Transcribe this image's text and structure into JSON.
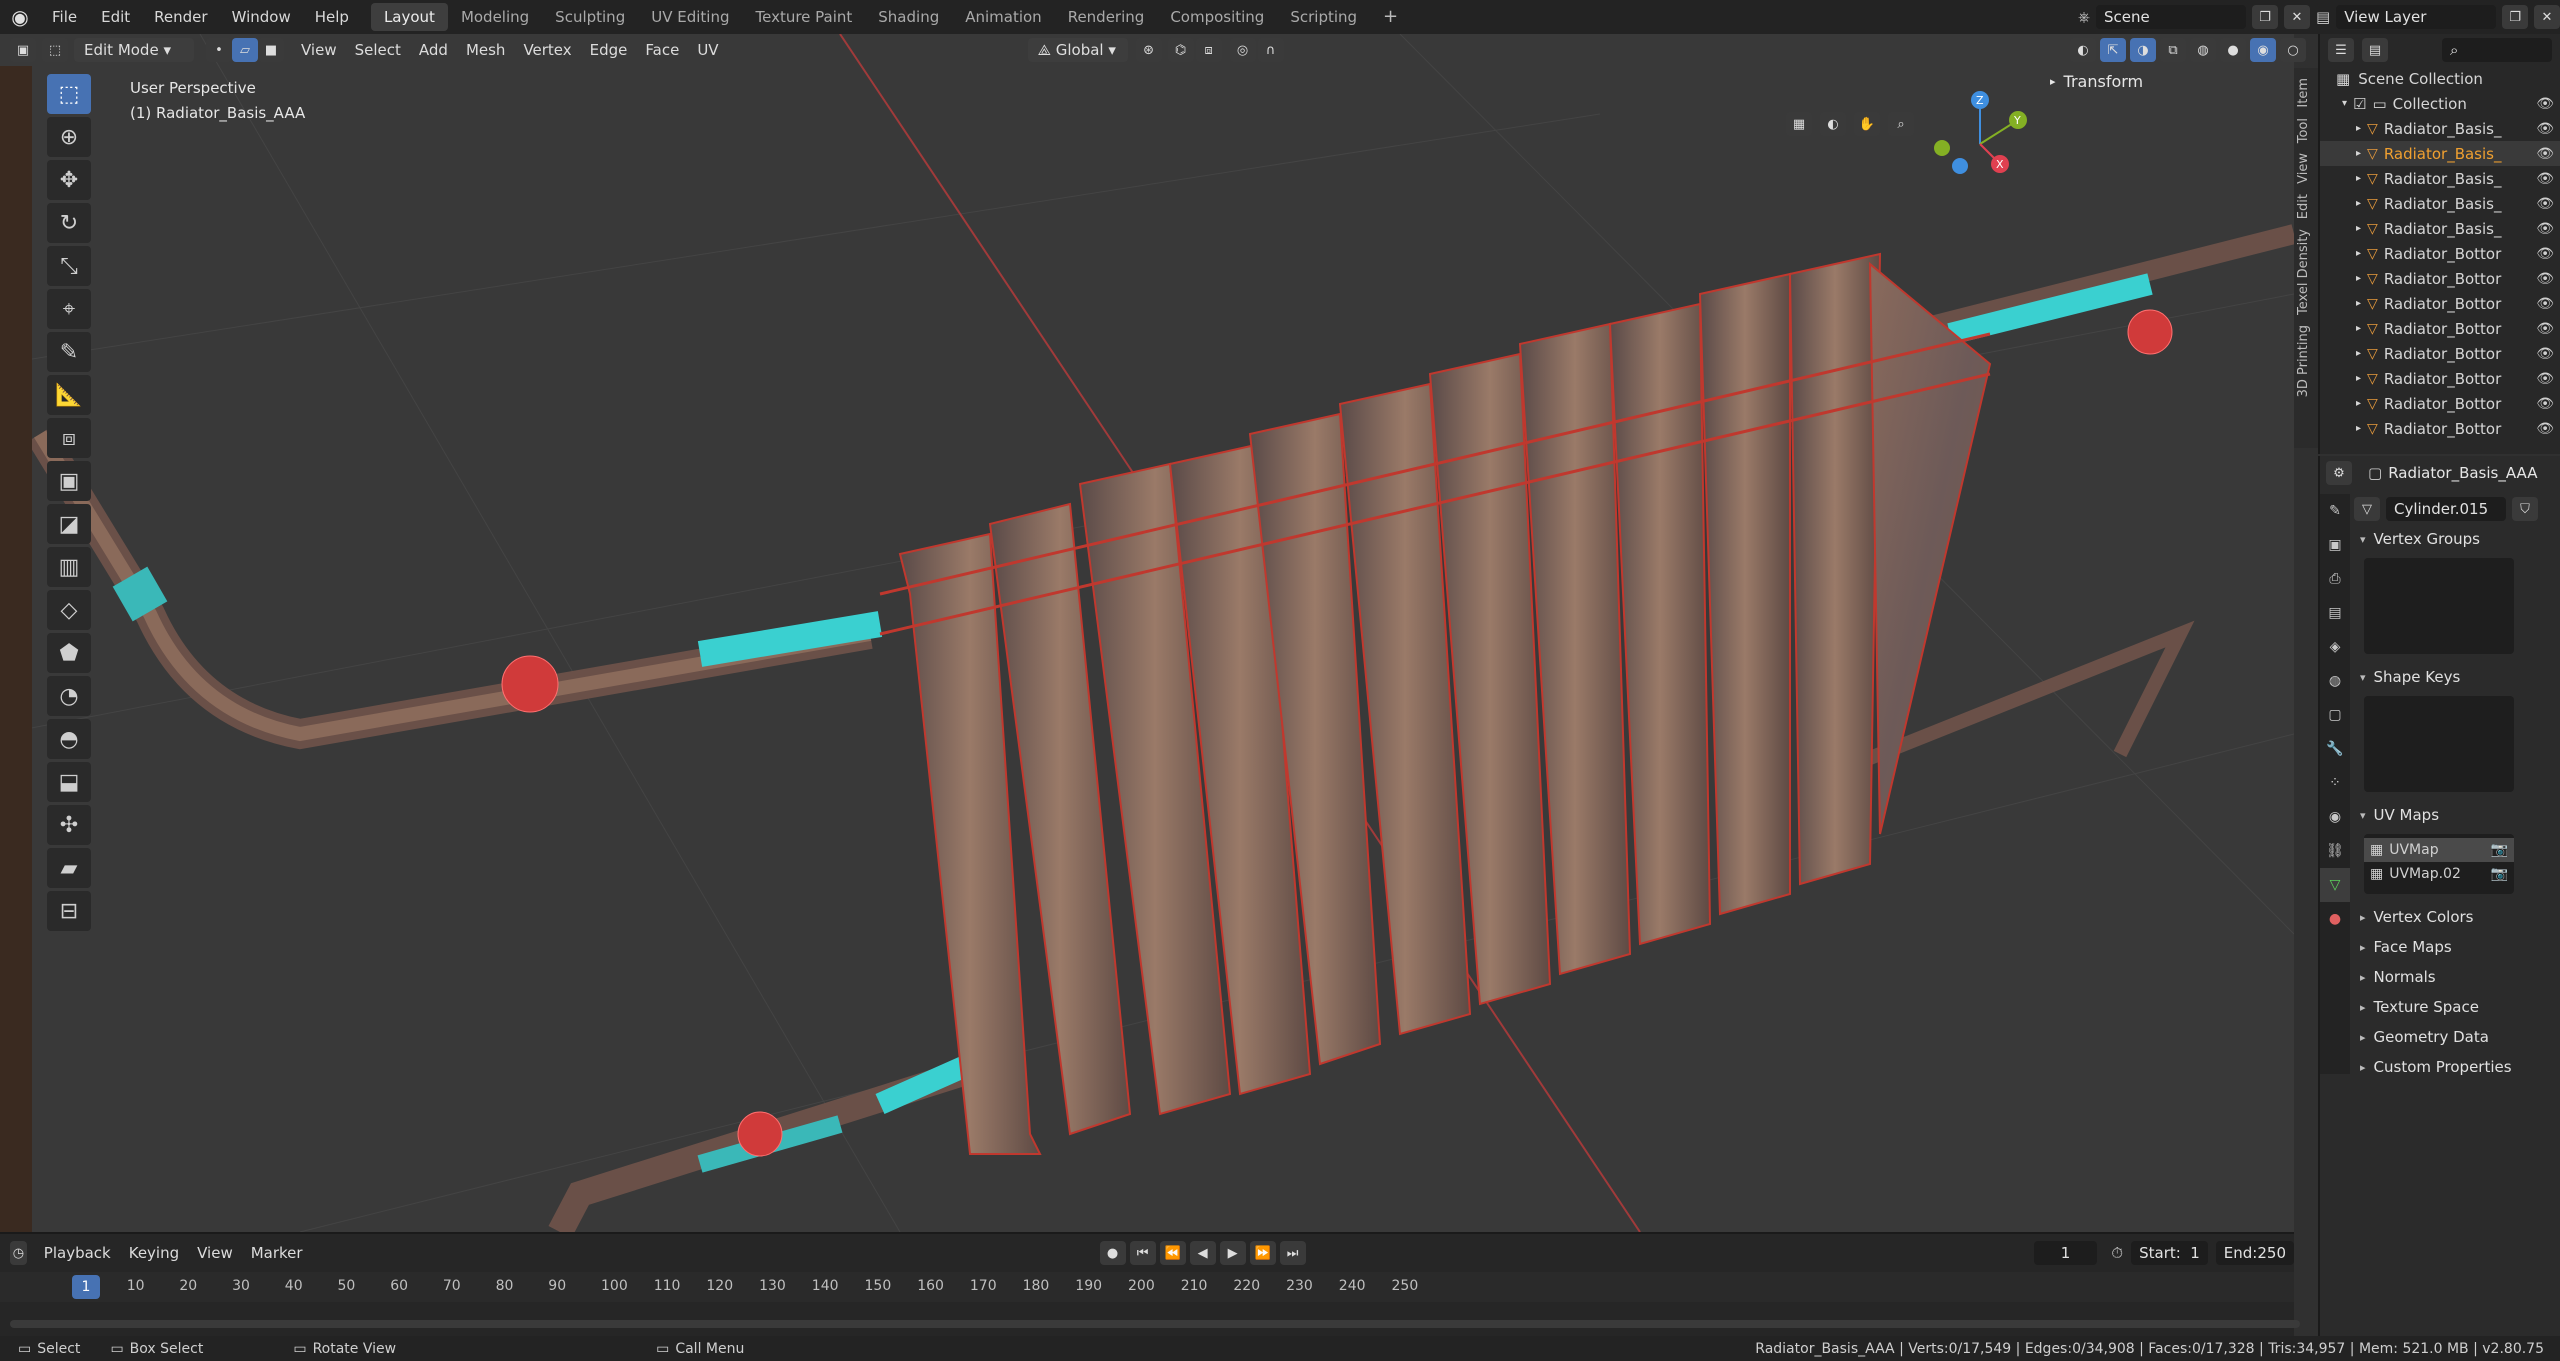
{
  "topbar": {
    "menus": [
      "File",
      "Edit",
      "Render",
      "Window",
      "Help"
    ],
    "workspaces": [
      "Layout",
      "Modeling",
      "Sculpting",
      "UV Editing",
      "Texture Paint",
      "Shading",
      "Animation",
      "Rendering",
      "Compositing",
      "Scripting"
    ],
    "active_workspace": "Layout",
    "scene_name": "Scene",
    "view_layer": "View Layer"
  },
  "viewport_header": {
    "mode": "Edit Mode",
    "menus": [
      "View",
      "Select",
      "Add",
      "Mesh",
      "Vertex",
      "Edge",
      "Face",
      "UV"
    ],
    "orientation": "Global"
  },
  "viewport": {
    "perspective_label": "User Perspective",
    "object_label": "(1) Radiator_Basis_AAA",
    "npanel_title": "Transform",
    "side_tabs": [
      "Item",
      "Tool",
      "View",
      "Edit",
      "Texel Density",
      "3D Printing"
    ],
    "gizmo_axes": [
      "Z",
      "Y",
      "X"
    ]
  },
  "outliner": {
    "root": "Scene Collection",
    "collection": "Collection",
    "items": [
      {
        "name": "Radiator_Basis_",
        "active": false
      },
      {
        "name": "Radiator_Basis_",
        "active": true
      },
      {
        "name": "Radiator_Basis_",
        "active": false
      },
      {
        "name": "Radiator_Basis_",
        "active": false
      },
      {
        "name": "Radiator_Basis_",
        "active": false
      },
      {
        "name": "Radiator_Bottor",
        "active": false
      },
      {
        "name": "Radiator_Bottor",
        "active": false
      },
      {
        "name": "Radiator_Bottor",
        "active": false
      },
      {
        "name": "Radiator_Bottor",
        "active": false
      },
      {
        "name": "Radiator_Bottor",
        "active": false
      },
      {
        "name": "Radiator_Bottor",
        "active": false
      },
      {
        "name": "Radiator_Bottor",
        "active": false
      },
      {
        "name": "Radiator_Bottor",
        "active": false
      }
    ]
  },
  "properties": {
    "object_name": "Radiator_Basis_AAA",
    "mesh_name": "Cylinder.015",
    "sections": {
      "vertex_groups": "Vertex Groups",
      "shape_keys": "Shape Keys",
      "uv_maps": "UV Maps"
    },
    "uv_maps": [
      "UVMap",
      "UVMap.02"
    ],
    "collapsed": [
      "Vertex Colors",
      "Face Maps",
      "Normals",
      "Texture Space",
      "Geometry Data",
      "Custom Properties"
    ]
  },
  "timeline": {
    "menus": [
      "Playback",
      "Keying",
      "View",
      "Marker"
    ],
    "current_frame": "1",
    "start_label": "Start:",
    "start": "1",
    "end_label": "End:",
    "end": "250",
    "ruler": [
      "1",
      "10",
      "20",
      "30",
      "40",
      "50",
      "60",
      "70",
      "80",
      "90",
      "100",
      "110",
      "120",
      "130",
      "140",
      "150",
      "160",
      "170",
      "180",
      "190",
      "200",
      "210",
      "220",
      "230",
      "240",
      "250"
    ]
  },
  "status": {
    "select": "Select",
    "box_select": "Box Select",
    "rotate": "Rotate View",
    "call_menu": "Call Menu",
    "stats": "Radiator_Basis_AAA | Verts:0/17,549 | Edges:0/34,908 | Faces:0/17,328 | Tris:34,957 | Mem: 521.0 MB | v2.80.75"
  },
  "colors": {
    "accent": "#4772b3",
    "active_object": "#f0a030",
    "axis_x": "#e04050",
    "axis_y": "#84b024",
    "axis_z": "#3f8fe0",
    "mesh_rust": "#7a5a4a",
    "mesh_cyan": "#3ad0d0"
  }
}
